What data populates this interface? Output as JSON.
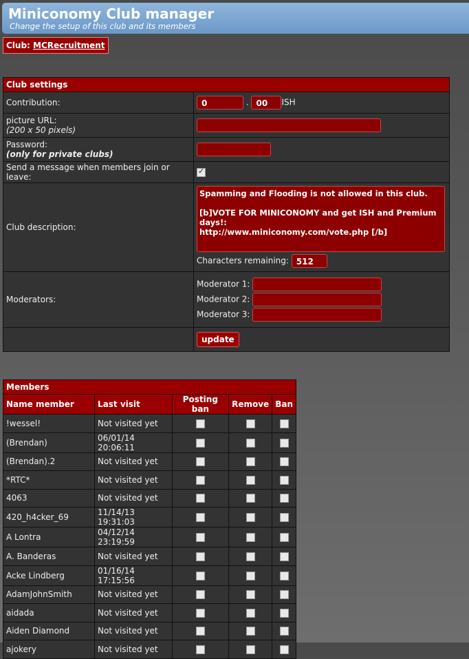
{
  "header": {
    "title": "Miniconomy Club manager",
    "subtitle": "Change the setup of this club and its members"
  },
  "club": {
    "label": "Club:",
    "name": "MCRecruitment"
  },
  "settings": {
    "title": "Club settings",
    "contribution_label": "Contribution:",
    "contribution_whole": "0",
    "contribution_dot": ".",
    "contribution_cents": "00",
    "currency": "ISH",
    "picture_label": "picture URL:",
    "picture_hint": "(200 x 50 pixels)",
    "picture_value": "",
    "password_label": "Password:",
    "password_hint": "(only for private clubs)",
    "password_value": "",
    "message_label": "Send a message when members join or leave:",
    "message_checked": true,
    "description_label": "Club description:",
    "description_value": "Spamming and Flooding is not allowed in this club.\n\n[b]VOTE FOR MINICONOMY and get ISH and Premium days!:\nhttp://www.miniconomy.com/vote.php [/b]",
    "chars_label": "Characters remaining:",
    "chars_value": "512",
    "moderators_label": "Moderators:",
    "moderator_labels": [
      "Moderator 1:",
      "Moderator 2:",
      "Moderator 3:"
    ],
    "update_label": "update"
  },
  "members": {
    "title": "Members",
    "columns": [
      "Name member",
      "Last visit",
      "Posting ban",
      "Remove",
      "Ban"
    ],
    "rows": [
      {
        "name": "!wessel!",
        "last": "Not visited yet"
      },
      {
        "name": "(Brendan)",
        "last": "06/01/14 20:06:11"
      },
      {
        "name": "(Brendan).2",
        "last": "Not visited yet"
      },
      {
        "name": "*RTC*",
        "last": "Not visited yet"
      },
      {
        "name": "4063",
        "last": "Not visited yet"
      },
      {
        "name": "420_h4cker_69",
        "last": "11/14/13 19:31:03"
      },
      {
        "name": "A Lontra",
        "last": "04/12/14 23:19:59"
      },
      {
        "name": "A. Banderas",
        "last": "Not visited yet"
      },
      {
        "name": "Acke Lindberg",
        "last": "01/16/14 17:15:56"
      },
      {
        "name": "AdamJohnSmith",
        "last": "Not visited yet"
      },
      {
        "name": "aidada",
        "last": "Not visited yet"
      },
      {
        "name": "Aiden Diamond",
        "last": "Not visited yet"
      },
      {
        "name": "ajokery",
        "last": "Not visited yet"
      }
    ]
  }
}
